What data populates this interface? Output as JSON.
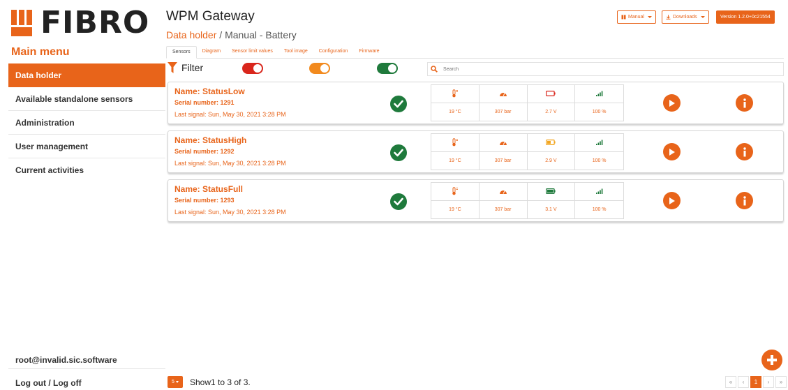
{
  "brand": {
    "logo_text": "FIBRO",
    "accent_color": "#e8641a"
  },
  "header": {
    "app_title": "WPM Gateway",
    "breadcrumb_link": "Data holder",
    "breadcrumb_separator": " / ",
    "breadcrumb_current": "Manual - Battery",
    "manual_label": "Manual",
    "downloads_label": "Downloads",
    "version_label": "Version 1.2.0+0c21554"
  },
  "sidebar": {
    "title": "Main menu",
    "items": [
      {
        "label": "Data holder",
        "active": true
      },
      {
        "label": "Available standalone sensors",
        "active": false
      },
      {
        "label": "Administration",
        "active": false
      },
      {
        "label": "User management",
        "active": false
      },
      {
        "label": "Current activities",
        "active": false
      }
    ],
    "user": "root@invalid.sic.software",
    "logout_label": "Log out / Log off"
  },
  "tabs": [
    {
      "label": "Sensors",
      "active": true
    },
    {
      "label": "Diagram",
      "active": false
    },
    {
      "label": "Sensor limit values",
      "active": false
    },
    {
      "label": "Tool image",
      "active": false
    },
    {
      "label": "Configuration",
      "active": false
    },
    {
      "label": "Firmware",
      "active": false
    }
  ],
  "filter": {
    "label": "Filter",
    "toggles": [
      {
        "color": "#d9261c",
        "state": "on"
      },
      {
        "color": "#f28a1e",
        "state": "on"
      },
      {
        "color": "#1f7a3c",
        "state": "on"
      }
    ],
    "search_placeholder": "Search"
  },
  "sensors": [
    {
      "name": "Name: StatusLow",
      "serial": "Serial number: 1291",
      "last_signal": "Last signal: Sun, May 30, 2021 3:28 PM",
      "status_icon": "check-circle-icon",
      "battery_level": "low",
      "temperature": "19 °C",
      "pressure": "307 bar",
      "voltage": "2.7 V",
      "signal_strength": "100 %"
    },
    {
      "name": "Name: StatusHigh",
      "serial": "Serial number: 1292",
      "last_signal": "Last signal: Sun, May 30, 2021 3:28 PM",
      "status_icon": "check-circle-icon",
      "battery_level": "high",
      "temperature": "19 °C",
      "pressure": "307 bar",
      "voltage": "2.9 V",
      "signal_strength": "100 %"
    },
    {
      "name": "Name: StatusFull",
      "serial": "Serial number: 1293",
      "last_signal": "Last signal: Sun, May 30, 2021 3:28 PM",
      "status_icon": "check-circle-icon",
      "battery_level": "full",
      "temperature": "19 °C",
      "pressure": "307 bar",
      "voltage": "3.1 V",
      "signal_strength": "100 %"
    }
  ],
  "footer": {
    "page_size": "5",
    "showing_text": "Show1 to 3 of 3.",
    "pager": {
      "first": "«",
      "prev": "‹",
      "current_page": "1",
      "next": "›",
      "last": "»"
    }
  }
}
